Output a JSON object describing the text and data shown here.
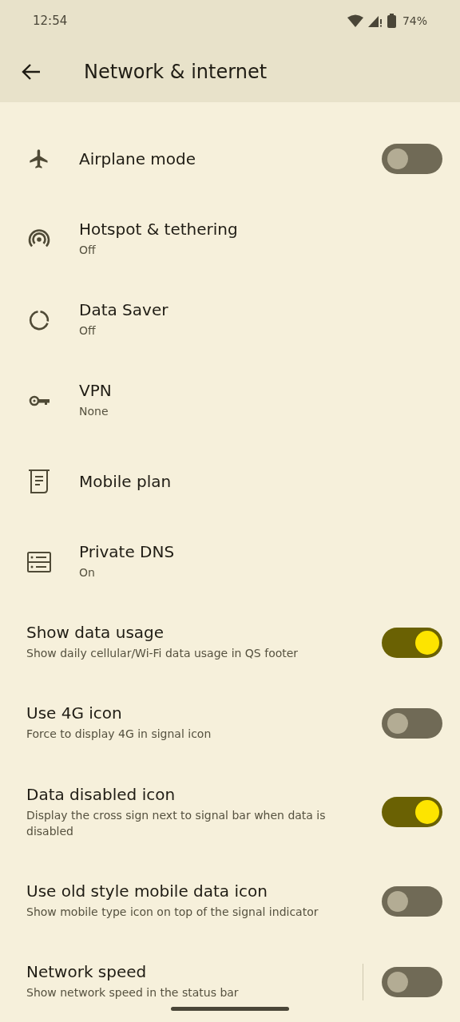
{
  "status_bar": {
    "time": "12:54",
    "battery": "74%"
  },
  "toolbar": {
    "title": "Network & internet"
  },
  "items": [
    {
      "kind": "icon",
      "title": "Airplane mode",
      "on": false
    },
    {
      "kind": "icon",
      "title": "Hotspot & tethering",
      "summary": "Off"
    },
    {
      "kind": "icon",
      "title": "Data Saver",
      "summary": "Off"
    },
    {
      "kind": "icon",
      "title": "VPN",
      "summary": "None"
    },
    {
      "kind": "icon",
      "title": "Mobile plan"
    },
    {
      "kind": "icon",
      "title": "Private DNS",
      "summary": "On"
    },
    {
      "kind": "plain",
      "title": "Show data usage",
      "summary": "Show daily cellular/Wi-Fi data usage in QS footer",
      "on": true
    },
    {
      "kind": "plain",
      "title": "Use 4G icon",
      "summary": "Force to display 4G in signal icon",
      "on": false
    },
    {
      "kind": "plain",
      "title": "Data disabled icon",
      "summary": "Display the cross sign next to signal bar when data is disabled",
      "on": true
    },
    {
      "kind": "plain",
      "title": "Use old style mobile data icon",
      "summary": "Show mobile type icon on top of the signal indicator",
      "on": false
    },
    {
      "kind": "plain",
      "title": "Network speed",
      "summary": "Show network speed in the status bar",
      "on": false,
      "divider": true
    }
  ]
}
